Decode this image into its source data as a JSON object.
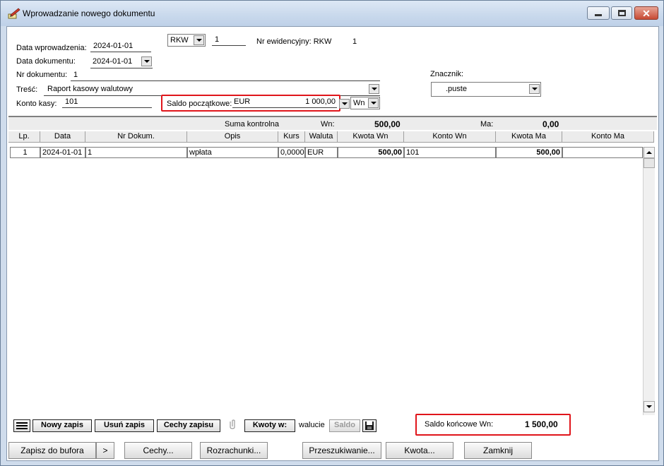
{
  "window": {
    "title": "Wprowadzanie nowego dokumentu"
  },
  "form": {
    "data_wprowadzenia_label": "Data wprowadzenia:",
    "data_wprowadzenia_value": "2024-01-01",
    "data_dokumentu_label": "Data dokumentu:",
    "data_dokumentu_value": "2024-01-01",
    "nr_dokumentu_label": "Nr dokumentu:",
    "nr_dokumentu_value": "1",
    "tresc_label": "Treść:",
    "tresc_value": "Raport kasowy walutowy",
    "konto_kasy_label": "Konto kasy:",
    "konto_kasy_value": "101",
    "doc_type": "RKW",
    "doc_number": "1",
    "nr_ewidencyjny_label": "Nr ewidencyjny: RKW",
    "nr_ewidencyjny_value": "1",
    "saldo_poczatkowe_label": "Saldo początkowe:",
    "saldo_poczatkowe_currency": "EUR",
    "saldo_poczatkowe_value": "1 000,00",
    "saldo_side": "Wn",
    "znacznik_label": "Znacznik:",
    "znacznik_value": ".puste"
  },
  "summary": {
    "suma_kontrolna_label": "Suma kontrolna",
    "wn_label": "Wn:",
    "wn_value": "500,00",
    "ma_label": "Ma:",
    "ma_value": "0,00"
  },
  "table": {
    "columns": [
      "Lp.",
      "Data",
      "Nr Dokum.",
      "Opis",
      "Kurs",
      "Waluta",
      "Kwota Wn",
      "Konto Wn",
      "Kwota Ma",
      "Konto Ma"
    ],
    "rows": [
      [
        "1",
        "2024-01-01",
        "1",
        "wpłata",
        "0,0000",
        "EUR",
        "500,00",
        "101",
        "500,00",
        ""
      ]
    ]
  },
  "toolbar": {
    "nowy_zapis": "Nowy zapis",
    "usun_zapis": "Usuń zapis",
    "cechy_zapisu": "Cechy zapisu",
    "kwoty_w": "Kwoty w:",
    "walucie": "walucie",
    "saldo": "Saldo",
    "saldo_koncowe_label": "Saldo końcowe Wn:",
    "saldo_koncowe_value": "1 500,00"
  },
  "footer": {
    "zapisz_do_bufora": "Zapisz do bufora",
    "more": ">",
    "cechy": "Cechy...",
    "rozrachunki": "Rozrachunki...",
    "przeszukiwanie": "Przeszukiwanie...",
    "kwota": "Kwota...",
    "zamknij": "Zamknij"
  },
  "colors": {
    "highlight_border": "#e0151b",
    "window_frame": "#cfdcec",
    "close_button": "#c74a34"
  },
  "icons": {
    "app": "pen-paper-icon",
    "minimize": "minimize-icon",
    "maximize": "maximize-icon",
    "close": "close-icon"
  }
}
